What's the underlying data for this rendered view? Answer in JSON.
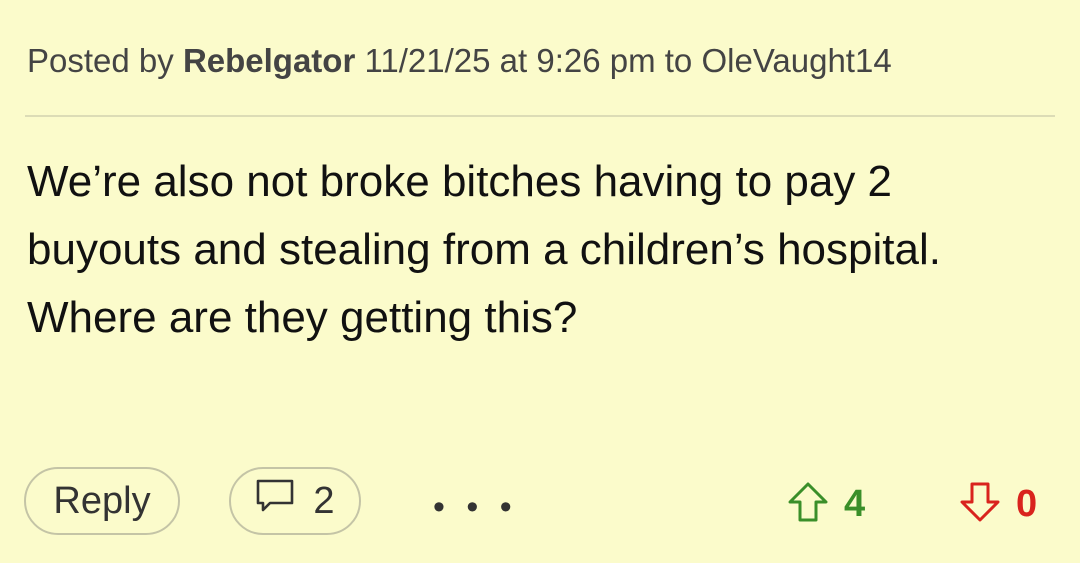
{
  "post": {
    "posted_by_prefix": "Posted by",
    "author": "Rebelgator",
    "timestamp": "11/21/25 at 9:26 pm",
    "to_prefix": "to",
    "reply_to": "OleVaught14",
    "body": "We’re also not broke bitches having to pay 2 buyouts and stealing from a children’s hospital. Where are they getting this?"
  },
  "actions": {
    "reply_label": "Reply",
    "comment_count": "2",
    "more_label": "• • •",
    "upvotes": "4",
    "downvotes": "0"
  },
  "icons": {
    "comment": "speech-bubble-icon",
    "upvote": "up-arrow-icon",
    "downvote": "down-arrow-icon"
  },
  "colors": {
    "background": "#FBFBCB",
    "upvote": "#3A8F29",
    "downvote": "#D9231D"
  }
}
